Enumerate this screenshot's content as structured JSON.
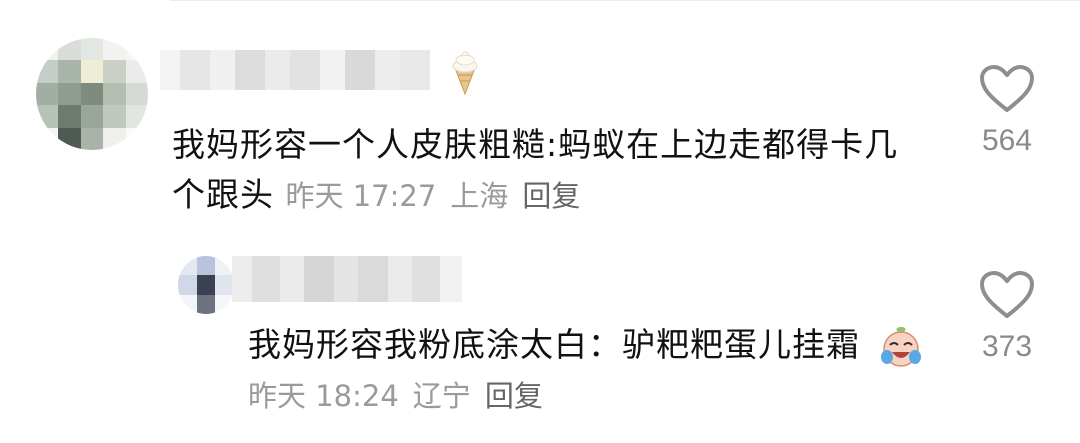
{
  "comments": [
    {
      "text": "我妈形容一个人皮肤粗糙:蚂蚁在上边走都得卡几个跟头",
      "time": "昨天 17:27",
      "location": "上海",
      "reply_label": "回复",
      "likes": "564",
      "has_icecream_badge": true
    },
    {
      "text": "我妈形容我粉底涂太白：驴粑粑蛋儿挂霜",
      "time_partial": "昨天 18:24",
      "location_partial": "辽宁",
      "reply_label": "回复",
      "likes": "373",
      "emoji": "laugh-cry-emoji"
    }
  ],
  "icons": {
    "like": "heart-outline-icon"
  },
  "colors": {
    "text": "#111111",
    "meta": "#9a9a9a",
    "count": "#8a8a8a"
  }
}
